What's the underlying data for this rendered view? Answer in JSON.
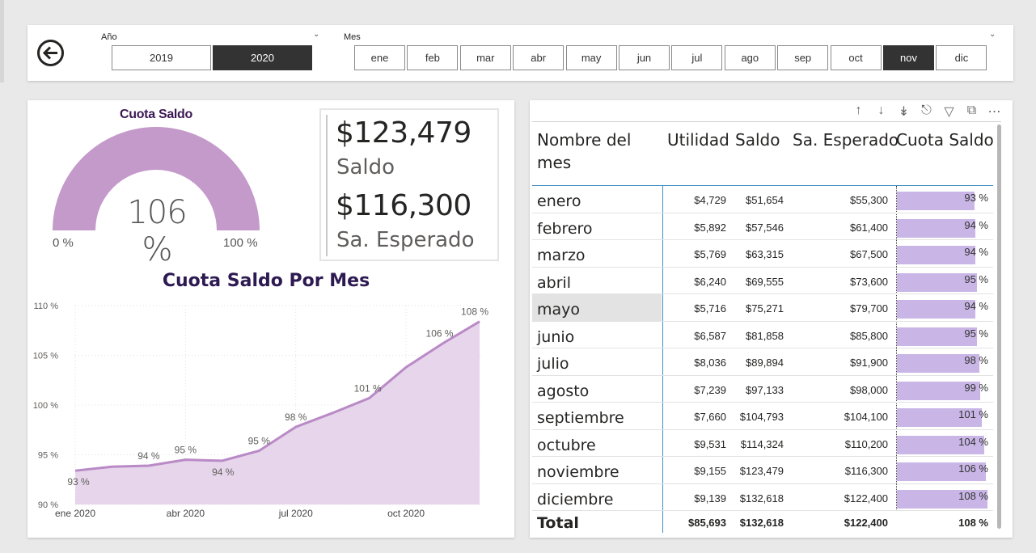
{
  "filters": {
    "year_title": "Año",
    "years": [
      {
        "label": "2019",
        "selected": false
      },
      {
        "label": "2020",
        "selected": true
      }
    ],
    "month_title": "Mes",
    "months": [
      {
        "label": "ene",
        "selected": false
      },
      {
        "label": "feb",
        "selected": false
      },
      {
        "label": "mar",
        "selected": false
      },
      {
        "label": "abr",
        "selected": false
      },
      {
        "label": "may",
        "selected": false
      },
      {
        "label": "jun",
        "selected": false
      },
      {
        "label": "jul",
        "selected": false
      },
      {
        "label": "ago",
        "selected": false
      },
      {
        "label": "sep",
        "selected": false
      },
      {
        "label": "oct",
        "selected": false
      },
      {
        "label": "nov",
        "selected": true
      },
      {
        "label": "dic",
        "selected": false
      }
    ]
  },
  "gauge": {
    "title": "Cuota Saldo",
    "value_label": "106 %",
    "value": 106,
    "min_label": "0 %",
    "max_label": "100 %",
    "min": 0,
    "max": 100,
    "color": "#c49acb"
  },
  "card": {
    "saldo_value": "$123,479",
    "saldo_label": "Saldo",
    "esperado_value": "$116,300",
    "esperado_label": "Sa. Esperado"
  },
  "chart_data": {
    "type": "area",
    "title": "Cuota Saldo Por Mes",
    "xlabel": "",
    "ylabel": "",
    "x": [
      "ene 2020",
      "feb 2020",
      "mar 2020",
      "abr 2020",
      "may 2020",
      "jun 2020",
      "jul 2020",
      "ago 2020",
      "sep 2020",
      "oct 2020",
      "nov 2020",
      "dic 2020"
    ],
    "x_tick_labels": [
      "ene 2020",
      "abr 2020",
      "jul 2020",
      "oct 2020"
    ],
    "values": [
      93.4,
      93.8,
      93.9,
      94.5,
      94.4,
      95.4,
      97.8,
      99.2,
      100.7,
      103.8,
      106.2,
      108.4
    ],
    "data_labels": [
      "93 %",
      "",
      "94 %",
      "95 %",
      "94 %",
      "95 %",
      "98 %",
      "",
      "101 %",
      "",
      "106 %",
      "108 %"
    ],
    "y_ticks": [
      "90 %",
      "95 %",
      "100 %",
      "105 %",
      "110 %"
    ],
    "ylim": [
      90,
      110
    ],
    "grid": true,
    "line_color": "#b98ac6",
    "fill_color": "#e6d5eb"
  },
  "table": {
    "toolbar_icons": [
      "arrow-up-icon",
      "arrow-down-icon",
      "double-arrow-down-icon",
      "expand-hierarchy-icon",
      "filter-icon",
      "focus-mode-icon",
      "more-options-icon"
    ],
    "headers": [
      "Nombre del mes",
      "Utilidad",
      "Saldo",
      "Sa. Esperado",
      "Cuota Saldo"
    ],
    "rows": [
      {
        "mes": "enero",
        "utilidad": "$4,729",
        "saldo": "$51,654",
        "esperado": "$55,300",
        "cuota": "93 %",
        "pct": 93
      },
      {
        "mes": "febrero",
        "utilidad": "$5,892",
        "saldo": "$57,546",
        "esperado": "$61,400",
        "cuota": "94 %",
        "pct": 94
      },
      {
        "mes": "marzo",
        "utilidad": "$5,769",
        "saldo": "$63,315",
        "esperado": "$67,500",
        "cuota": "94 %",
        "pct": 94
      },
      {
        "mes": "abril",
        "utilidad": "$6,240",
        "saldo": "$69,555",
        "esperado": "$73,600",
        "cuota": "95 %",
        "pct": 95
      },
      {
        "mes": "mayo",
        "utilidad": "$5,716",
        "saldo": "$75,271",
        "esperado": "$79,700",
        "cuota": "94 %",
        "pct": 94
      },
      {
        "mes": "junio",
        "utilidad": "$6,587",
        "saldo": "$81,858",
        "esperado": "$85,800",
        "cuota": "95 %",
        "pct": 95
      },
      {
        "mes": "julio",
        "utilidad": "$8,036",
        "saldo": "$89,894",
        "esperado": "$91,900",
        "cuota": "98 %",
        "pct": 98
      },
      {
        "mes": "agosto",
        "utilidad": "$7,239",
        "saldo": "$97,133",
        "esperado": "$98,000",
        "cuota": "99 %",
        "pct": 99
      },
      {
        "mes": "septiembre",
        "utilidad": "$7,660",
        "saldo": "$104,793",
        "esperado": "$104,100",
        "cuota": "101 %",
        "pct": 101
      },
      {
        "mes": "octubre",
        "utilidad": "$9,531",
        "saldo": "$114,324",
        "esperado": "$110,200",
        "cuota": "104 %",
        "pct": 104
      },
      {
        "mes": "noviembre",
        "utilidad": "$9,155",
        "saldo": "$123,479",
        "esperado": "$116,300",
        "cuota": "106 %",
        "pct": 106
      },
      {
        "mes": "diciembre",
        "utilidad": "$9,139",
        "saldo": "$132,618",
        "esperado": "$122,400",
        "cuota": "108 %",
        "pct": 108
      }
    ],
    "total": {
      "mes": "Total",
      "utilidad": "$85,693",
      "saldo": "$132,618",
      "esperado": "$122,400",
      "cuota": "108 %"
    },
    "bar_color": "#c9b6e6"
  }
}
